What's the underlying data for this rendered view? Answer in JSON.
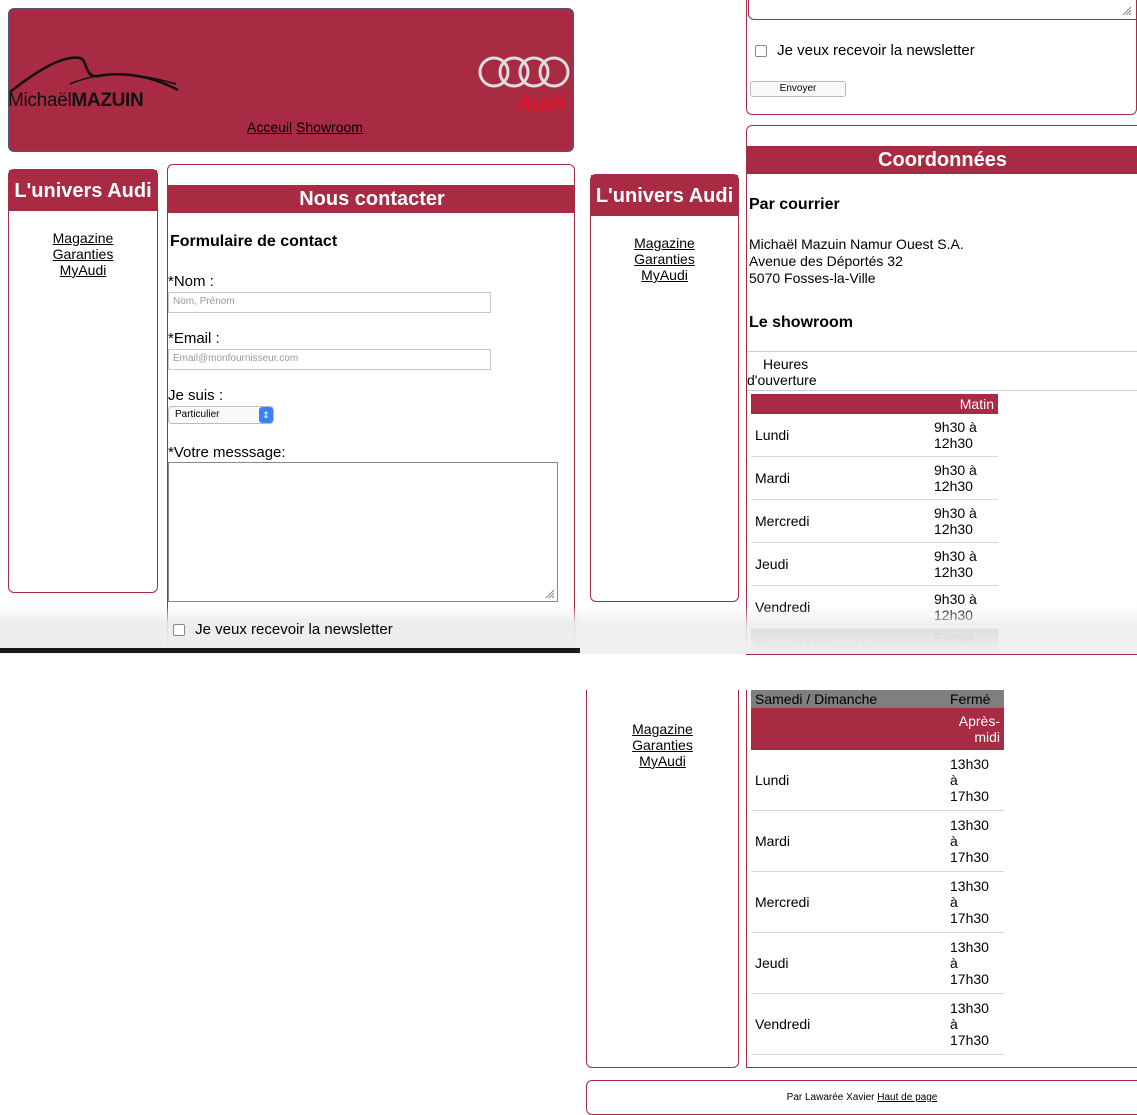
{
  "header": {
    "logo_text_regular": "Michaël",
    "logo_text_bold": "MAZUIN",
    "brand_word": "Audi",
    "nav": [
      "Acceuil",
      "Showroom"
    ]
  },
  "sidebar": {
    "title": "L'univers Audi",
    "links": [
      "Magazine",
      "Garanties",
      "MyAudi"
    ]
  },
  "contact": {
    "title": "Nous contacter",
    "form_title": "Formulaire de contact",
    "name_label": "*Nom :",
    "name_placeholder": "Nom, Prénom",
    "email_label": "*Email :",
    "email_placeholder": "Email@monfournisseur.com",
    "type_label": "Je suis :",
    "type_selected": "Particulier",
    "message_label": "*Votre messsage:",
    "newsletter_label": "Je veux recevoir la newsletter",
    "submit_label": "Envoyer"
  },
  "coordinates": {
    "title": "Coordonnées",
    "mail_title": "Par courrier",
    "address": [
      "Michaël Mazuin Namur Ouest S.A.",
      "Avenue des Déportés 32",
      "5070 Fosses-la-Ville"
    ],
    "showroom_title": "Le showroom",
    "hours_caption_1": "Heures",
    "hours_caption_2": "d'ouverture",
    "morning_header": "Matin",
    "afternoon_header_1": "Après-",
    "afternoon_header_2": "midi",
    "days": [
      "Lundi",
      "Mardi",
      "Mercredi",
      "Jeudi",
      "Vendredi"
    ],
    "weekend": "Samedi / Dimanche",
    "closed": "Fermé",
    "morning_hours_1": "9h30 à",
    "morning_hours_2": "12h30",
    "afternoon_1": "13h30",
    "afternoon_2": "à",
    "afternoon_3": "17h30"
  },
  "footer": {
    "credit": "Par Lawarée Xavier",
    "top_link": "Haut de page"
  }
}
